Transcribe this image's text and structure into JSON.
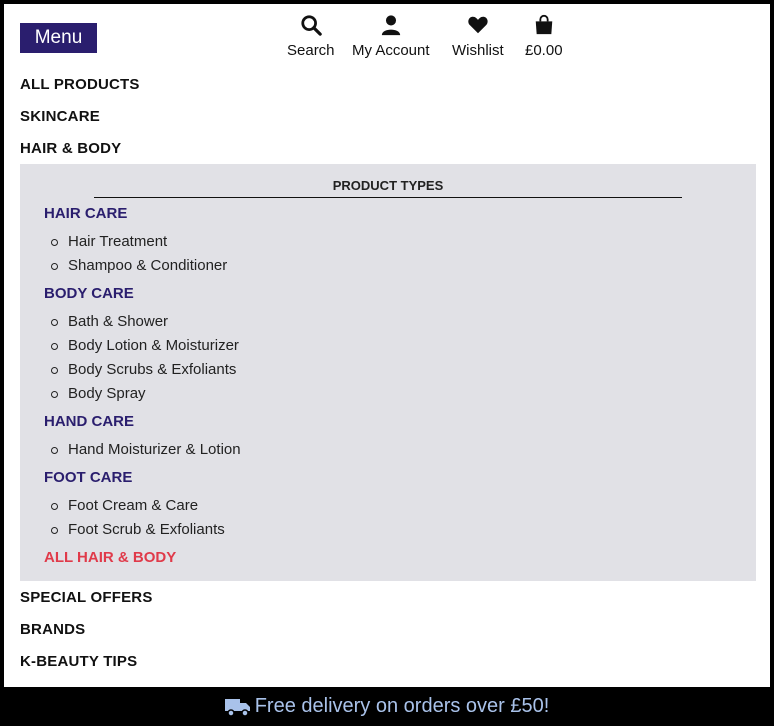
{
  "header": {
    "menu_label": "Menu",
    "search_label": "Search",
    "account_label": "My Account",
    "wishlist_label": "Wishlist",
    "cart_label": "£0.00"
  },
  "nav": {
    "all_products": "ALL PRODUCTS",
    "skincare": "SKINCARE",
    "hair_body": "HAIR & BODY",
    "special_offers": "SPECIAL OFFERS",
    "brands": "BRANDS",
    "kbeauty_tips": "K-BEAUTY TIPS"
  },
  "dropdown": {
    "title": "PRODUCT TYPES",
    "hair_care": {
      "label": "HAIR CARE",
      "items": [
        "Hair Treatment",
        "Shampoo & Conditioner"
      ]
    },
    "body_care": {
      "label": "BODY CARE",
      "items": [
        "Bath & Shower",
        "Body Lotion & Moisturizer",
        "Body Scrubs & Exfoliants",
        "Body Spray"
      ]
    },
    "hand_care": {
      "label": "HAND CARE",
      "items": [
        "Hand Moisturizer & Lotion"
      ]
    },
    "foot_care": {
      "label": "FOOT CARE",
      "items": [
        "Foot Cream & Care",
        "Foot Scrub & Exfoliants"
      ]
    },
    "all_label": "ALL HAIR & BODY"
  },
  "banner": {
    "text": "Free delivery on orders over £50!",
    "icon": "truck-icon"
  },
  "colors": {
    "brand_purple": "#2a1e6e",
    "accent_red": "#e03a4a",
    "dropdown_bg": "#e1e1e6",
    "banner_text": "#a9c2ea"
  }
}
